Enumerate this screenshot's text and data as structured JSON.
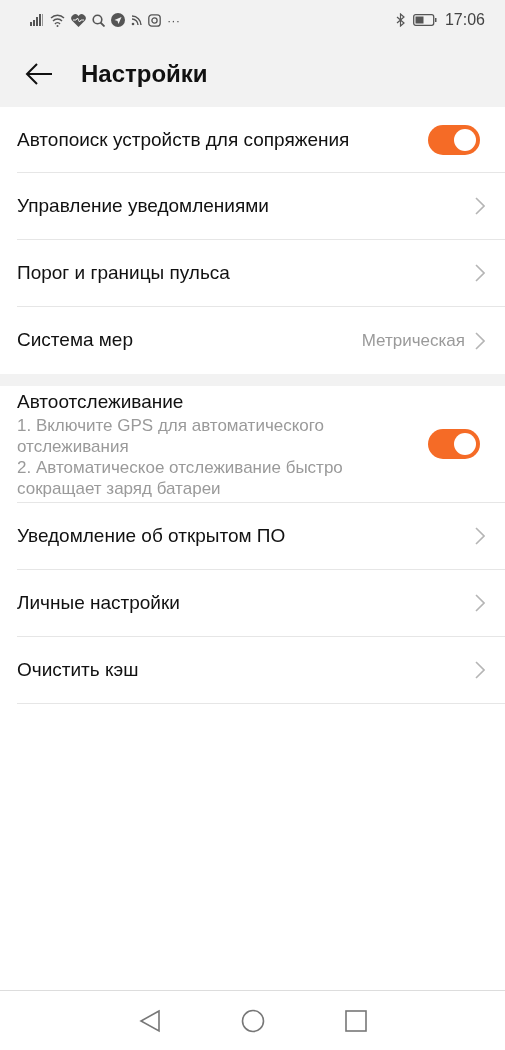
{
  "status_bar": {
    "time": "17:06",
    "overflow": "···"
  },
  "header": {
    "title": "Настройки"
  },
  "sections": [
    {
      "items": [
        {
          "kind": "toggle",
          "label": "Автопоиск устройств для сопряжения",
          "on": true
        },
        {
          "kind": "link",
          "label": "Управление уведомлениями"
        },
        {
          "kind": "link",
          "label": "Порог и границы пульса"
        },
        {
          "kind": "link",
          "label": "Система мер",
          "value": "Метрическая"
        }
      ]
    },
    {
      "items": [
        {
          "kind": "toggle",
          "label": "Автоотслеживание",
          "description": [
            "1. Включите GPS для автоматического отслеживания",
            "2. Автоматическое отслеживание быстро сокращает заряд батареи"
          ],
          "on": true
        },
        {
          "kind": "link",
          "label": "Уведомление об открытом ПО"
        },
        {
          "kind": "link",
          "label": "Личные настройки"
        },
        {
          "kind": "link",
          "label": "Очистить кэш"
        }
      ]
    }
  ]
}
